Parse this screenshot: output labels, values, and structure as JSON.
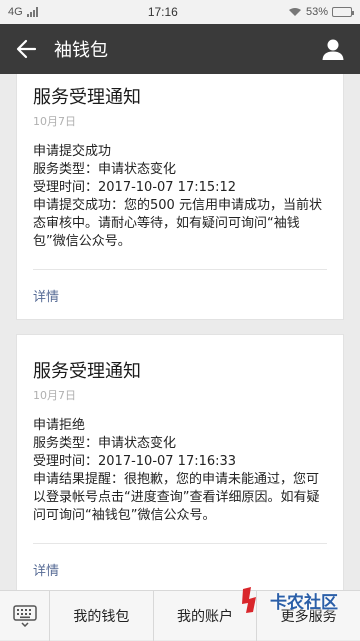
{
  "status_bar": {
    "network": "4G",
    "time": "17:16",
    "battery": "53%",
    "battery_level": 0.53
  },
  "app_bar": {
    "title": "袖钱包",
    "back_icon": "back-arrow-icon",
    "user_icon": "user-profile-icon"
  },
  "cards": [
    {
      "title": "服务受理通知",
      "date": "10月7日",
      "lines": [
        "申请提交成功",
        "服务类型：申请状态变化",
        "受理时间：2017-10-07 17:15:12",
        "申请提交成功：您的500 元信用申请成功，当前状态审核中。请耐心等待，如有疑问可询问“袖钱包”微信公众号。"
      ],
      "details": "详情"
    },
    {
      "title": "服务受理通知",
      "date": "10月7日",
      "lines": [
        "申请拒绝",
        "服务类型：申请状态变化",
        "受理时间：2017-10-07 17:16:33",
        "申请结果提醒：很抱歉，您的申请未能通过，您可以登录帐号点击“进度查询”查看详细原因。如有疑问可询问“袖钱包”微信公众号。"
      ],
      "details": "详情"
    }
  ],
  "bottom_menu": {
    "keyboard_icon": "keyboard-icon",
    "items": [
      "我的钱包",
      "我的账户",
      "更多服务"
    ]
  },
  "watermark": {
    "text": "卡农社区"
  }
}
